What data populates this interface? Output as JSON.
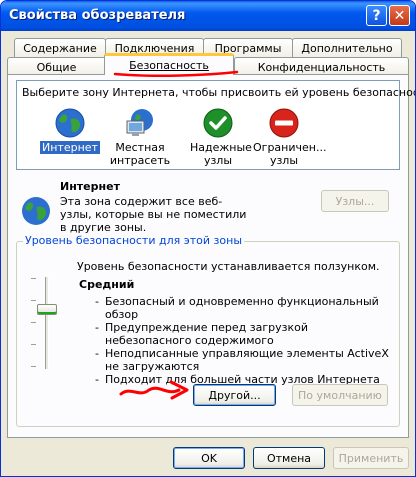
{
  "window": {
    "title": "Свойства обозревателя"
  },
  "titlebar": {
    "help_glyph": "?",
    "close_glyph": "✕"
  },
  "tabs": {
    "back_row": [
      {
        "label": "Содержание"
      },
      {
        "label": "Подключения"
      },
      {
        "label": "Программы"
      },
      {
        "label": "Дополнительно"
      }
    ],
    "front_row": [
      {
        "label": "Общие"
      },
      {
        "label": "Безопасность"
      },
      {
        "label": "Конфиденциальность"
      }
    ],
    "active": "Безопасность"
  },
  "zones": {
    "caption": "Выберите зону Интернета, чтобы присвоить ей уровень безопасности.",
    "items": [
      {
        "label": "Интернет",
        "icon": "globe-icon",
        "selected": true
      },
      {
        "label": "Местная интрасеть",
        "icon": "intranet-computer-icon"
      },
      {
        "label": "Надежные узлы",
        "icon": "check-icon"
      },
      {
        "label": "Ограничен... узлы",
        "icon": "restricted-icon"
      }
    ],
    "detail": {
      "title": "Интернет",
      "description": "Эта зона содержит все веб-узлы, которые вы не поместили в другие зоны."
    },
    "sites_button": "Узлы..."
  },
  "security_level": {
    "legend": "Уровень безопасности для этой зоны",
    "slider_hint": "Уровень безопасности устанавливается ползунком.",
    "level_name": "Средний",
    "slider_position": "3 of 5",
    "bullets": [
      "Безопасный и одновременно функциональный обзор",
      "Предупреждение перед загрузкой небезопасного содержимого",
      "Неподписанные управляющие элементы ActiveX не загружаются",
      "Подходит для большей части узлов Интернета"
    ],
    "custom_button": "Другой...",
    "default_button": "По умолчанию"
  },
  "footer": {
    "ok": "OK",
    "cancel": "Отмена",
    "apply": "Применить"
  },
  "colors": {
    "title_bar": "#0058ee",
    "active_tab_accent": "#ffc83c",
    "annotation_arrow": "#ff0000",
    "selection": "#316ac5",
    "groupbox_legend": "#0046d5"
  }
}
